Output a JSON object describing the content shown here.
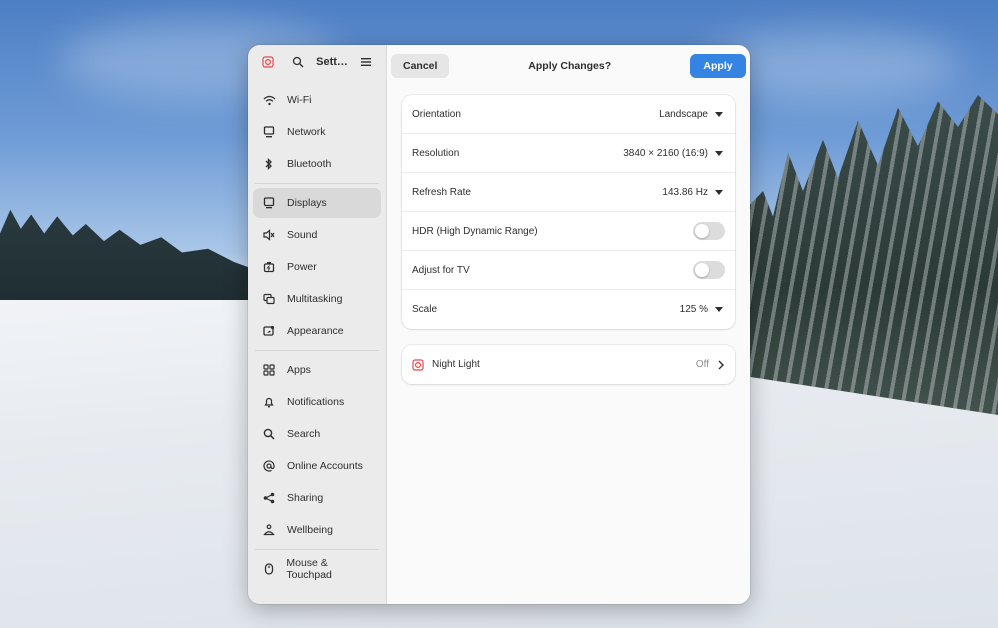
{
  "sidebar": {
    "title": "Sett…",
    "icons": {
      "app": "settings-app-icon",
      "search": "search-icon",
      "menu": "hamburger-menu-icon"
    },
    "groups": [
      [
        {
          "label": "Wi-Fi",
          "icon": "wifi-icon"
        },
        {
          "label": "Network",
          "icon": "network-icon"
        },
        {
          "label": "Bluetooth",
          "icon": "bluetooth-icon"
        }
      ],
      [
        {
          "label": "Displays",
          "icon": "display-icon",
          "active": true
        },
        {
          "label": "Sound",
          "icon": "sound-icon"
        },
        {
          "label": "Power",
          "icon": "power-icon"
        },
        {
          "label": "Multitasking",
          "icon": "multitasking-icon"
        },
        {
          "label": "Appearance",
          "icon": "appearance-icon"
        }
      ],
      [
        {
          "label": "Apps",
          "icon": "apps-icon"
        },
        {
          "label": "Notifications",
          "icon": "bell-icon"
        },
        {
          "label": "Search",
          "icon": "search-icon"
        },
        {
          "label": "Online Accounts",
          "icon": "at-icon"
        },
        {
          "label": "Sharing",
          "icon": "share-icon"
        },
        {
          "label": "Wellbeing",
          "icon": "wellbeing-icon"
        }
      ],
      [
        {
          "label": "Mouse & Touchpad",
          "icon": "mouse-icon"
        }
      ]
    ]
  },
  "header": {
    "cancel_label": "Cancel",
    "title": "Apply Changes?",
    "apply_label": "Apply"
  },
  "settings": {
    "orientation": {
      "label": "Orientation",
      "value": "Landscape"
    },
    "resolution": {
      "label": "Resolution",
      "value": "3840 × 2160 (16:9)"
    },
    "refresh_rate": {
      "label": "Refresh Rate",
      "value": "143.86 Hz"
    },
    "hdr": {
      "label": "HDR (High Dynamic Range)",
      "enabled": false
    },
    "adjust_tv": {
      "label": "Adjust for TV",
      "enabled": false
    },
    "scale": {
      "label": "Scale",
      "value": "125 %"
    }
  },
  "night_light": {
    "label": "Night Light",
    "status": "Off"
  },
  "colors": {
    "accent": "#3584e4",
    "sidebar_bg": "#ebebeb",
    "active_item": "#d9d9d9"
  }
}
